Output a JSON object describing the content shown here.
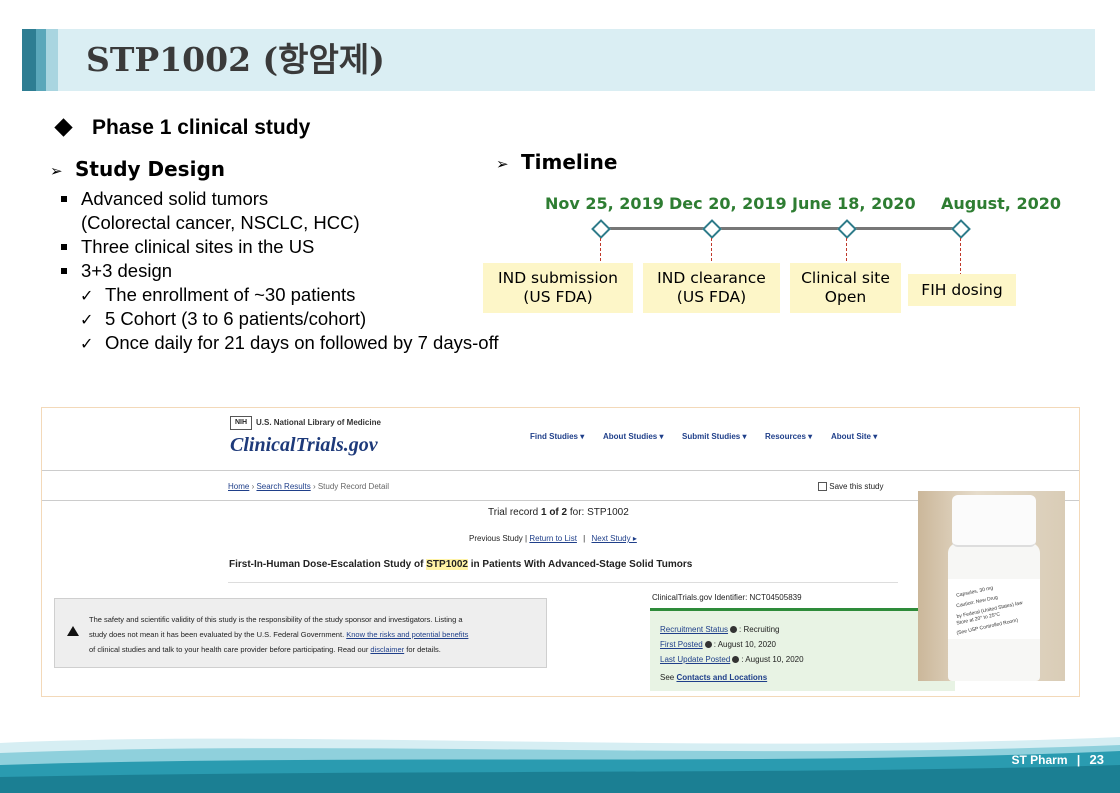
{
  "title": "STP1002 (항암제)",
  "phase_heading": "Phase 1 clinical study",
  "study_design": {
    "heading": "Study Design",
    "bullets": [
      "Advanced solid tumors",
      "(Colorectal cancer, NSCLC, HCC)",
      "Three clinical sites in the US",
      "3+3 design"
    ],
    "checks": [
      "The enrollment of ~30 patients",
      "5 Cohort (3 to 6 patients/cohort)",
      "Once daily for 21 days on followed by 7 days-off"
    ]
  },
  "timeline": {
    "heading": "Timeline",
    "events": [
      {
        "date": "Nov 25, 2019",
        "label_1": "IND submission",
        "label_2": "(US FDA)"
      },
      {
        "date": "Dec 20, 2019",
        "label_1": "IND clearance",
        "label_2": "(US FDA)"
      },
      {
        "date": "June 18, 2020",
        "label_1": "Clinical site",
        "label_2": "Open"
      },
      {
        "date": "August, 2020",
        "label_1": "FIH dosing",
        "label_2": ""
      }
    ]
  },
  "clinicaltrials": {
    "nih_badge": "NIH",
    "nih_text": "U.S. National Library of Medicine",
    "logo": "ClinicalTrials.gov",
    "nav": [
      "Find Studies ▾",
      "About Studies ▾",
      "Submit Studies ▾",
      "Resources ▾",
      "About Site ▾"
    ],
    "breadcrumb_home": "Home",
    "breadcrumb_results": "Search Results",
    "breadcrumb_current": "Study Record Detail",
    "save_label": "Save this study",
    "trial_record_prefix": "Trial record ",
    "trial_record_bold": "1 of 2",
    "trial_record_suffix": " for:   STP1002",
    "previous_study": "Previous Study |",
    "return_to_list": "Return to List",
    "separator": "|",
    "next_study": "Next Study ▸",
    "study_title_a": "First-In-Human Dose-Escalation Study of ",
    "study_title_hl": "STP1002",
    "study_title_b": " in Patients With Advanced-Stage Solid Tumors",
    "disclaimer_1": "The safety and scientific validity of this study is the responsibility of the study sponsor and investigators. Listing a",
    "disclaimer_2a": "study does not mean it has been evaluated by the U.S. Federal Government. ",
    "disclaimer_2_link": "Know the risks and potential benefits",
    "disclaimer_3a": "of clinical studies and talk to your health care provider before participating. Read our ",
    "disclaimer_3_link": "disclaimer",
    "disclaimer_3b": " for details.",
    "identifier": "ClinicalTrials.gov Identifier: NCT04505839",
    "recruitment_label": "Recruitment Status",
    "recruitment_value": ": Recruiting",
    "first_posted_label": "First Posted",
    "first_posted_value": ": August 10, 2020",
    "last_update_label": "Last Update Posted",
    "last_update_value": ": August 10, 2020",
    "see_prefix": "See ",
    "contacts_link": "Contacts and Locations",
    "bottle_label_lines": [
      "Capsules, 30 mg",
      "Caution: New Drug",
      "by Federal (United States) law",
      "Store at 20° to 25°C",
      "(See USP Controlled Room)"
    ]
  },
  "footer": {
    "brand": "ST Pharm",
    "separator": "|",
    "page": "23"
  }
}
